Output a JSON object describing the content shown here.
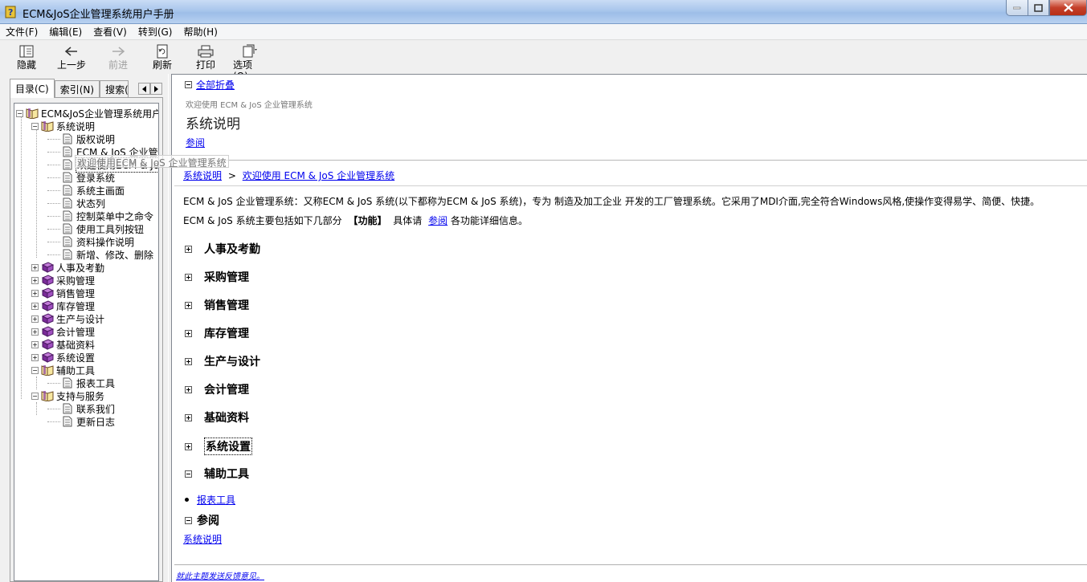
{
  "window": {
    "title": "ECM&JoS企业管理系统用户手册"
  },
  "menu": [
    "文件(F)",
    "编辑(E)",
    "查看(V)",
    "转到(G)",
    "帮助(H)"
  ],
  "toolbar": {
    "hide": "隐藏",
    "back": "上一步",
    "forward": "前进",
    "refresh": "刷新",
    "print": "打印",
    "options": "选项(O)"
  },
  "tabs": {
    "contents": "目录(C)",
    "index": "索引(N)",
    "search": "搜索(S)"
  },
  "tree": {
    "root": "ECM&JoS企业管理系统用户",
    "system_desc": "系统说明",
    "copyright": "版权说明",
    "intro": "ECM & JoS 企业管",
    "welcome": "欢迎使用ECM & JoS",
    "login": "登录系统",
    "main_screen": "系统主画面",
    "statusbar": "状态列",
    "menu_cmds": "控制菜单中之命令",
    "toolbar_btns": "使用工具列按钮",
    "data_ops": "资料操作说明",
    "add_edit": "新增、修改、删除",
    "hr": "人事及考勤",
    "purchase": "采购管理",
    "sales": "销售管理",
    "inventory": "库存管理",
    "production": "生产与设计",
    "accounting": "会计管理",
    "basic_data": "基础资料",
    "settings": "系统设置",
    "aux_tools": "辅助工具",
    "report_tool": "报表工具",
    "support": "支持与服务",
    "contact": "联系我们",
    "changelog": "更新日志",
    "tooltip": "欢迎使用ECM & JoS 企业管理系统"
  },
  "header": {
    "collapse_all": "全部折叠",
    "subtitle": "欢迎使用 ECM & JoS 企业管理系统",
    "title": "系统说明",
    "see_also": "参阅"
  },
  "content": {
    "crumb_link": "系统说明",
    "crumb_sep": ">",
    "crumb_current": "欢迎使用 ECM & JoS 企业管理系统",
    "para1": "ECM & JoS 企业管理系统：又称ECM & JoS 系统(以下都称为ECM & JoS 系统)，专为 制造及加工企业 开发的工厂管理系统。它采用了MDI介面,完全符合Windows风格,使操作变得易学、简便、快捷。",
    "para2_a": "ECM & JoS 系统主要包括如下几部分",
    "para2_b": "【功能】",
    "para2_c": "具体请",
    "para2_link": "参阅",
    "para2_d": "各功能详细信息。",
    "sections": [
      "人事及考勤",
      "采购管理",
      "销售管理",
      "库存管理",
      "生产与设计",
      "会计管理",
      "基础资料",
      "系统设置",
      "辅助工具"
    ],
    "aux_item": "报表工具",
    "see_also_title": "参阅",
    "see_also_link": "系统说明",
    "feedback": "就此主题发送反馈意见。"
  }
}
